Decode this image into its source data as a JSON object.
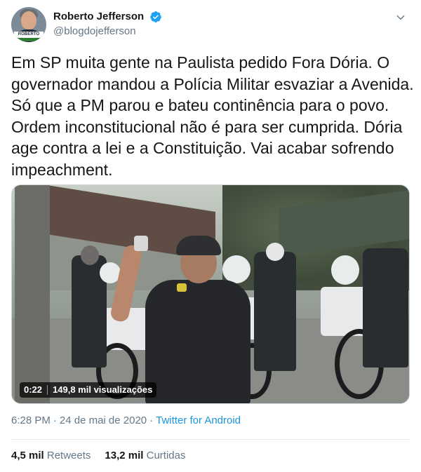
{
  "author": {
    "display_name": "Roberto Jefferson",
    "handle": "@blogdojefferson",
    "verified": true,
    "avatar_tag": "ROBERTO"
  },
  "tweet": {
    "text": "Em SP muita gente na Paulista pedido Fora Dória. O\ngovernador mandou a Polícia Militar esvaziar a Avenida.\nSó que a PM parou e bateu continência para o povo.\nOrdem inconstitucional não é para ser cumprida. Dória\nage contra a lei e a Constituição. Vai acabar sofrendo\nimpeachment."
  },
  "media": {
    "type": "video",
    "duration": "0:22",
    "views": "149,8 mil visualizações"
  },
  "meta": {
    "time": "6:28 PM",
    "separator": "·",
    "date": "24 de mai de 2020",
    "source": "Twitter for Android"
  },
  "stats": {
    "retweets_count": "4,5 mil",
    "retweets_label": "Retweets",
    "likes_count": "13,2 mil",
    "likes_label": "Curtidas"
  },
  "colors": {
    "link": "#1b95e0",
    "secondary_text": "#657786",
    "primary_text": "#14171a",
    "verified": "#1da1f2"
  },
  "icons": {
    "verified": "verified-badge-icon",
    "caret": "chevron-down-icon"
  }
}
